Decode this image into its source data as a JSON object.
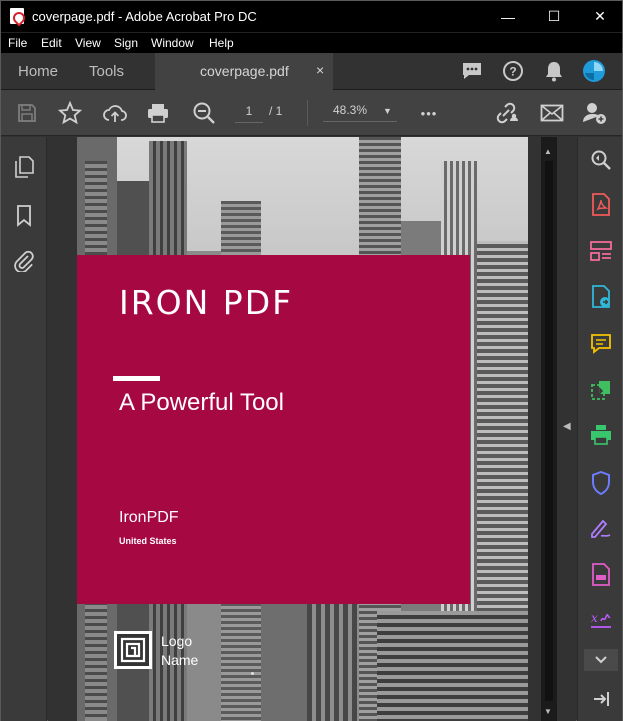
{
  "window": {
    "title": "coverpage.pdf - Adobe Acrobat Pro DC",
    "minimize_glyph": "—",
    "maximize_glyph": "☐",
    "close_glyph": "✕"
  },
  "menu": [
    "File",
    "Edit",
    "View",
    "Sign",
    "Window",
    "Help"
  ],
  "tabs": {
    "home": "Home",
    "tools": "Tools",
    "document": "coverpage.pdf",
    "close_glyph": "×"
  },
  "toolbar": {
    "page_current": "1",
    "page_total": "/ 1",
    "zoom": "48.3%",
    "more_glyph": "•••"
  },
  "document": {
    "title": "IRON PDF",
    "subtitle": "A Powerful Tool",
    "company": "IronPDF",
    "country": "United States",
    "logo_text": "Logo\nName",
    "accent_color": "#a60842"
  },
  "right_tools": [
    {
      "name": "enhance-scans-icon",
      "color": "#cfcfcf"
    },
    {
      "name": "create-pdf-icon",
      "color": "#f15a5a"
    },
    {
      "name": "organize-pages-icon",
      "color": "#f26b9b"
    },
    {
      "name": "export-pdf-icon",
      "color": "#2fb9d8"
    },
    {
      "name": "comment-icon",
      "color": "#f5c400"
    },
    {
      "name": "combine-files-icon",
      "color": "#3fbf5f"
    },
    {
      "name": "print-production-icon",
      "color": "#38c76c"
    },
    {
      "name": "protect-icon",
      "color": "#6c7cff"
    },
    {
      "name": "fill-sign-icon",
      "color": "#b07cff"
    },
    {
      "name": "compress-pdf-icon",
      "color": "#e05cc7"
    },
    {
      "name": "prepare-form-icon",
      "color": "#c05cff"
    }
  ]
}
